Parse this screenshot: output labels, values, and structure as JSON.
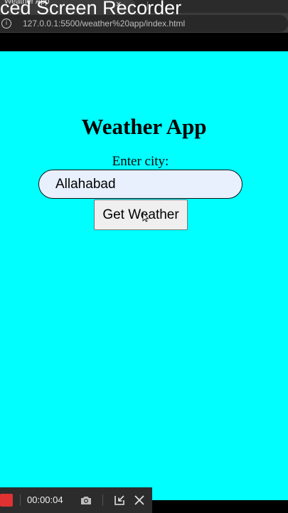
{
  "browser": {
    "tab_title": "Weather App",
    "tab_close": "×",
    "url": "127.0.0.1:5500/weather%20app/index.html",
    "info_glyph": "i"
  },
  "overlay": {
    "title": "ced Screen Recorder"
  },
  "page": {
    "background": "#00ffff",
    "heading": "Weather App",
    "city_label": "Enter city:",
    "city_value": "Allahabad",
    "button_label": "Get Weather"
  },
  "recorder": {
    "time": "00:00:04",
    "record_color": "#e03232"
  },
  "icons": {
    "camera": "camera-icon",
    "minimize": "collapse-icon",
    "close": "close-icon",
    "info": "info-icon",
    "cursor": "mouse-pointer-icon"
  }
}
